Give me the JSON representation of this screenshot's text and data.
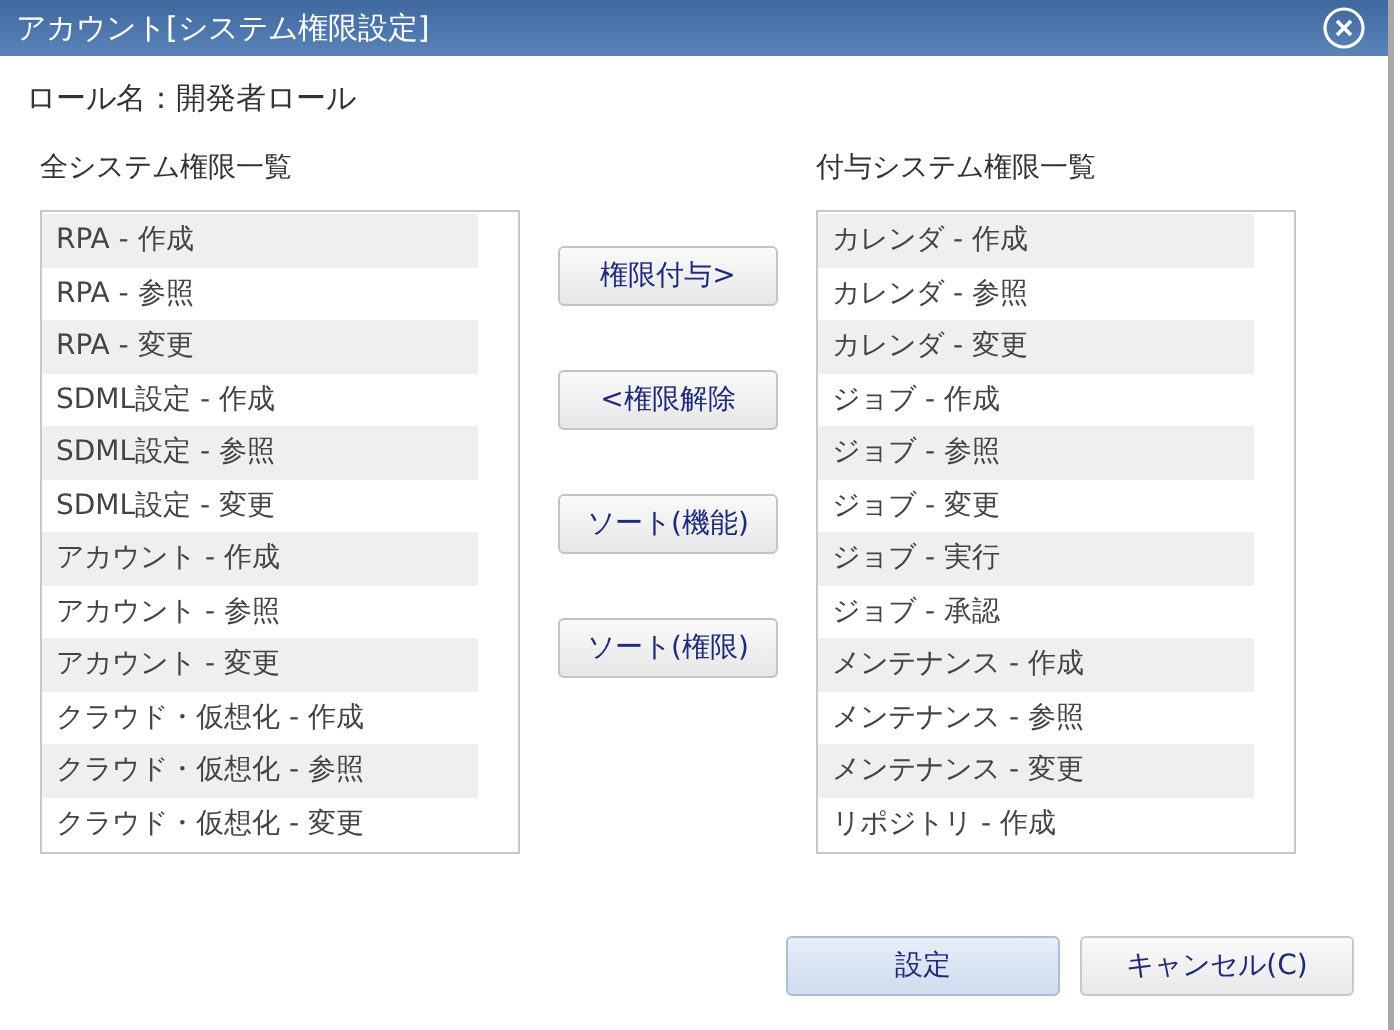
{
  "window": {
    "title": "アカウント[システム権限設定]"
  },
  "role_label": "ロール名：開発者ロール",
  "all_permissions": {
    "heading": "全システム権限一覧",
    "items": [
      "RPA - 作成",
      "RPA - 参照",
      "RPA - 変更",
      "SDML設定 - 作成",
      "SDML設定 - 参照",
      "SDML設定 - 変更",
      "アカウント - 作成",
      "アカウント - 参照",
      "アカウント - 変更",
      "クラウド・仮想化 - 作成",
      "クラウド・仮想化 - 参照",
      "クラウド・仮想化 - 変更"
    ]
  },
  "move_buttons": [
    "権限付与>",
    "<権限解除",
    "ソート(機能)",
    "ソート(権限)"
  ],
  "granted_permissions": {
    "heading": "付与システム権限一覧",
    "items": [
      "カレンダ - 作成",
      "カレンダ - 参照",
      "カレンダ - 変更",
      "ジョブ - 作成",
      "ジョブ - 参照",
      "ジョブ - 変更",
      "ジョブ - 実行",
      "ジョブ - 承認",
      "メンテナンス - 作成",
      "メンテナンス - 参照",
      "メンテナンス - 変更",
      "リポジトリ - 作成"
    ]
  },
  "footer_buttons": [
    {
      "label": "設定",
      "kind": "primary"
    },
    {
      "label": "キャンセル(C)",
      "kind": "normal"
    }
  ]
}
